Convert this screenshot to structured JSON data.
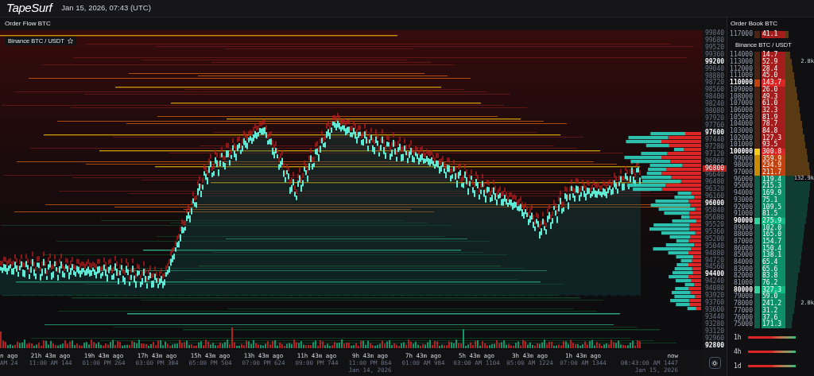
{
  "header": {
    "logo": "TapeSurf",
    "datetime": "Jan 15, 2026, 07:43 (UTC)"
  },
  "order_flow": {
    "title": "Order Flow BTC",
    "market": "Binance BTC / USDT",
    "price_axis": [
      {
        "label": "99840",
        "kind": "minor"
      },
      {
        "label": "99680",
        "kind": "minor"
      },
      {
        "label": "99520",
        "kind": "minor"
      },
      {
        "label": "99360",
        "kind": "minor"
      },
      {
        "label": "99200",
        "kind": "major"
      },
      {
        "label": "99040",
        "kind": "minor"
      },
      {
        "label": "98880",
        "kind": "minor"
      },
      {
        "label": "98720",
        "kind": "minor"
      },
      {
        "label": "98560",
        "kind": "minor"
      },
      {
        "label": "98400",
        "kind": "minor"
      },
      {
        "label": "98240",
        "kind": "minor"
      },
      {
        "label": "98080",
        "kind": "minor"
      },
      {
        "label": "97920",
        "kind": "minor"
      },
      {
        "label": "97760",
        "kind": "minor"
      },
      {
        "label": "97600",
        "kind": "major"
      },
      {
        "label": "97440",
        "kind": "minor"
      },
      {
        "label": "97280",
        "kind": "minor"
      },
      {
        "label": "97120",
        "kind": "minor"
      },
      {
        "label": "96960",
        "kind": "minor"
      },
      {
        "label": "96800",
        "kind": "current"
      },
      {
        "label": "96640",
        "kind": "minor"
      },
      {
        "label": "96480",
        "kind": "minor"
      },
      {
        "label": "96320",
        "kind": "minor"
      },
      {
        "label": "96160",
        "kind": "minor"
      },
      {
        "label": "96000",
        "kind": "major"
      },
      {
        "label": "95840",
        "kind": "minor"
      },
      {
        "label": "95680",
        "kind": "minor"
      },
      {
        "label": "95520",
        "kind": "minor"
      },
      {
        "label": "95360",
        "kind": "minor"
      },
      {
        "label": "95200",
        "kind": "minor"
      },
      {
        "label": "95040",
        "kind": "minor"
      },
      {
        "label": "94880",
        "kind": "minor"
      },
      {
        "label": "94720",
        "kind": "minor"
      },
      {
        "label": "94560",
        "kind": "minor"
      },
      {
        "label": "94400",
        "kind": "major"
      },
      {
        "label": "94240",
        "kind": "minor"
      },
      {
        "label": "94080",
        "kind": "minor"
      },
      {
        "label": "93920",
        "kind": "minor"
      },
      {
        "label": "93760",
        "kind": "minor"
      },
      {
        "label": "93600",
        "kind": "minor"
      },
      {
        "label": "93440",
        "kind": "minor"
      },
      {
        "label": "93280",
        "kind": "minor"
      },
      {
        "label": "93120",
        "kind": "minor"
      },
      {
        "label": "92960",
        "kind": "minor"
      },
      {
        "label": "92800",
        "kind": "major"
      }
    ],
    "time_axis": [
      {
        "ago": "n ago",
        "time": "AM 24"
      },
      {
        "ago": "21h 43m ago",
        "time": "11:00 AM 144"
      },
      {
        "ago": "19h 43m ago",
        "time": "01:00 PM 264"
      },
      {
        "ago": "17h 43m ago",
        "time": "03:00 PM 384"
      },
      {
        "ago": "15h 43m ago",
        "time": "05:00 PM 504"
      },
      {
        "ago": "13h 43m ago",
        "time": "07:00 PM 624"
      },
      {
        "ago": "11h 43m ago",
        "time": "09:00 PM 744"
      },
      {
        "ago": "9h 43m ago",
        "time": "11:00 PM 864",
        "date": "Jan 14, 2026"
      },
      {
        "ago": "7h 43m ago",
        "time": "01:00 AM 984"
      },
      {
        "ago": "5h 43m ago",
        "time": "03:00 AM 1104"
      },
      {
        "ago": "3h 43m ago",
        "time": "05:00 AM 1224"
      },
      {
        "ago": "1h 43m ago",
        "time": "07:00 AM 1344"
      },
      {
        "ago": "now",
        "time": "08:43:00 AM 1447",
        "date": "Jan 15, 2026"
      }
    ]
  },
  "order_book": {
    "title": "Order Book BTC",
    "market": "Binance BTC / USDT",
    "rows": [
      {
        "price": "117000",
        "qty": "41.1",
        "kind": "ask",
        "major": false
      },
      {
        "kind": "label"
      },
      {
        "price": "114000",
        "qty": "14.7",
        "kind": "ask",
        "major": false
      },
      {
        "price": "113000",
        "qty": "52.9",
        "kind": "ask",
        "major": false,
        "note": "2.8k"
      },
      {
        "price": "112000",
        "qty": "28.4",
        "kind": "ask",
        "major": false
      },
      {
        "price": "111000",
        "qty": "45.0",
        "kind": "ask",
        "major": false
      },
      {
        "price": "110000",
        "qty": "143.7",
        "kind": "ask",
        "major": true
      },
      {
        "price": "109000",
        "qty": "26.0",
        "kind": "ask",
        "major": false
      },
      {
        "price": "108000",
        "qty": "49.3",
        "kind": "ask",
        "major": false
      },
      {
        "price": "107000",
        "qty": "61.0",
        "kind": "ask",
        "major": false
      },
      {
        "price": "106000",
        "qty": "32.3",
        "kind": "ask",
        "major": false
      },
      {
        "price": "105000",
        "qty": "81.9",
        "kind": "ask",
        "major": false
      },
      {
        "price": "104000",
        "qty": "78.7",
        "kind": "ask",
        "major": false
      },
      {
        "price": "103000",
        "qty": "84.8",
        "kind": "ask",
        "major": false
      },
      {
        "price": "102000",
        "qty": "127.3",
        "kind": "ask",
        "major": false
      },
      {
        "price": "101000",
        "qty": "93.5",
        "kind": "ask",
        "major": false
      },
      {
        "price": "100000",
        "qty": "300.8",
        "kind": "ask",
        "major": true
      },
      {
        "price": "99000",
        "qty": "359.9",
        "kind": "ask",
        "major": false
      },
      {
        "price": "98000",
        "qty": "234.9",
        "kind": "ask",
        "major": false
      },
      {
        "price": "97000",
        "qty": "211.7",
        "kind": "ask",
        "major": false
      },
      {
        "price": "96000",
        "qty": "119.4",
        "kind": "bid",
        "major": false,
        "note": "132.9k"
      },
      {
        "price": "95000",
        "qty": "215.3",
        "kind": "bid",
        "major": false
      },
      {
        "price": "94000",
        "qty": "169.9",
        "kind": "bid",
        "major": false
      },
      {
        "price": "93000",
        "qty": "75.1",
        "kind": "bid",
        "major": false
      },
      {
        "price": "92000",
        "qty": "109.5",
        "kind": "bid",
        "major": false
      },
      {
        "price": "91000",
        "qty": "81.5",
        "kind": "bid",
        "major": false
      },
      {
        "price": "90000",
        "qty": "275.9",
        "kind": "bid",
        "major": true
      },
      {
        "price": "89000",
        "qty": "102.0",
        "kind": "bid",
        "major": false
      },
      {
        "price": "88000",
        "qty": "165.0",
        "kind": "bid",
        "major": false
      },
      {
        "price": "87000",
        "qty": "154.7",
        "kind": "bid",
        "major": false
      },
      {
        "price": "86000",
        "qty": "150.4",
        "kind": "bid",
        "major": false
      },
      {
        "price": "85000",
        "qty": "138.1",
        "kind": "bid",
        "major": false
      },
      {
        "price": "84000",
        "qty": "65.4",
        "kind": "bid",
        "major": false
      },
      {
        "price": "83000",
        "qty": "65.6",
        "kind": "bid",
        "major": false
      },
      {
        "price": "82000",
        "qty": "83.8",
        "kind": "bid",
        "major": false
      },
      {
        "price": "81000",
        "qty": "76.2",
        "kind": "bid",
        "major": false
      },
      {
        "price": "80000",
        "qty": "327.3",
        "kind": "bid",
        "major": true
      },
      {
        "price": "79000",
        "qty": "59.0",
        "kind": "bid",
        "major": false
      },
      {
        "price": "78000",
        "qty": "241.2",
        "kind": "bid",
        "major": false,
        "note": "2.0k"
      },
      {
        "price": "77000",
        "qty": "31.2",
        "kind": "bid",
        "major": false
      },
      {
        "price": "76000",
        "qty": "37.6",
        "kind": "bid",
        "major": false
      },
      {
        "price": "75000",
        "qty": "171.3",
        "kind": "bid",
        "major": false
      }
    ],
    "periods": [
      "1h",
      "4h",
      "1d"
    ]
  }
}
